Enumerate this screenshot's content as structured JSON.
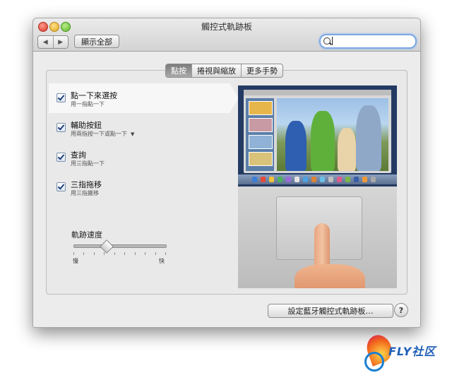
{
  "window": {
    "title": "觸控式軌跡板",
    "nav": {
      "back_icon": "◀",
      "forward_icon": "▶"
    },
    "show_all_label": "顯示全部",
    "search": {
      "value": "",
      "placeholder": ""
    }
  },
  "tabs": [
    {
      "label": "點按",
      "active": true
    },
    {
      "label": "捲視與縮放",
      "active": false
    },
    {
      "label": "更多手勢",
      "active": false
    }
  ],
  "options": [
    {
      "title": "點一下來選按",
      "subtitle": "用一指點一下",
      "checked": true,
      "selected": true
    },
    {
      "title": "輔助按鈕",
      "subtitle": "用兩指按一下或點一下",
      "checked": true,
      "selected": false,
      "has_dropdown": true
    },
    {
      "title": "查詢",
      "subtitle": "用三指點一下",
      "checked": true,
      "selected": false
    },
    {
      "title": "三指拖移",
      "subtitle": "用三指搬移",
      "checked": true,
      "selected": false
    }
  ],
  "tracking_speed": {
    "label": "軌跡速度",
    "min_label": "慢",
    "max_label": "快",
    "value": 0.35,
    "ticks": 10
  },
  "bluetooth_button_label": "設定藍牙觸控式軌跡板…",
  "help_label": "?",
  "watermark_text": "FLY社区",
  "colors": {
    "selection_blue": "#7aa7e6",
    "active_tab": "#8a8a8a"
  }
}
